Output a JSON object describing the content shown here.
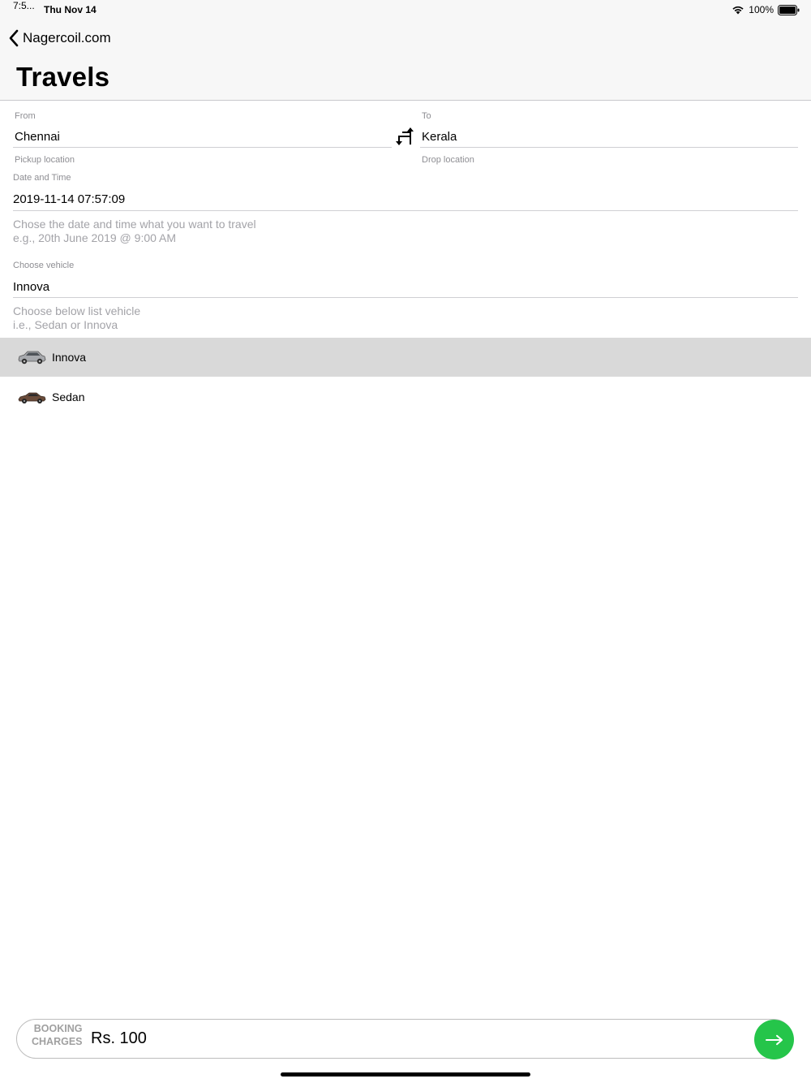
{
  "status_bar": {
    "time": "7:5...",
    "date": "Thu Nov 14",
    "battery": "100%"
  },
  "nav": {
    "back_label": "Nagercoil.com",
    "title": "Travels"
  },
  "form": {
    "from": {
      "label": "From",
      "value": "Chennai",
      "hint": "Pickup location"
    },
    "to": {
      "label": "To",
      "value": "Kerala",
      "hint": "Drop location"
    },
    "datetime": {
      "label": "Date and Time",
      "value": "2019-11-14 07:57:09",
      "hint_line1": "Chose the date and time what you want to travel",
      "hint_line2": "e.g., 20th June 2019 @ 9:00 AM"
    },
    "vehicle": {
      "label": "Choose vehicle",
      "value": "Innova",
      "hint_line1": "Choose below list vehicle",
      "hint_line2": "i.e., Sedan or Innova"
    }
  },
  "vehicles": [
    {
      "label": "Innova",
      "icon": "suv-car-icon",
      "selected": true
    },
    {
      "label": "Sedan",
      "icon": "sedan-car-icon",
      "selected": false
    }
  ],
  "booking": {
    "label_line1": "BOOKING",
    "label_line2": "CHARGES",
    "value": "Rs. 100"
  },
  "colors": {
    "accent_green": "#25c54a",
    "selected_row": "#d9d9d9"
  }
}
